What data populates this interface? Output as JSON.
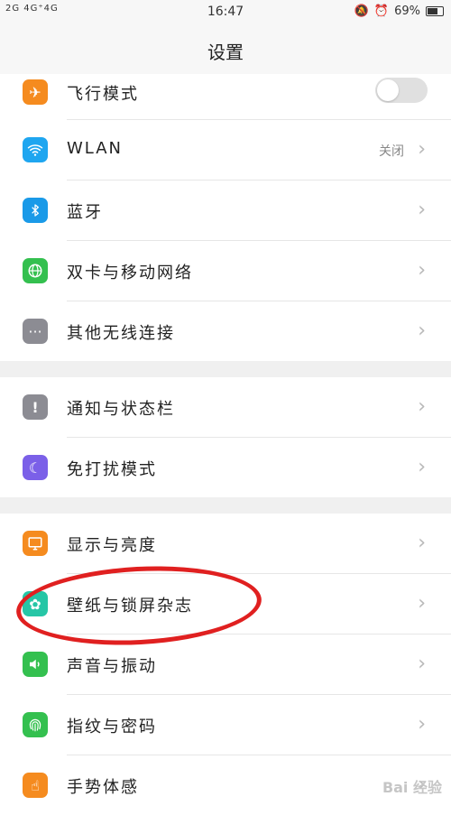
{
  "status_bar": {
    "signal": "2G 4G⁺4G",
    "time": "16:47",
    "battery": "69%"
  },
  "header": {
    "title": "设置"
  },
  "rows": [
    {
      "label": "飞行模式",
      "icon": "airplane-icon",
      "color": "#f58b1f"
    },
    {
      "label": "WLAN",
      "value": "关闭",
      "icon": "wifi-icon",
      "color": "#1fa6f0"
    },
    {
      "label": "蓝牙",
      "icon": "bluetooth-icon",
      "color": "#1a9ae8"
    },
    {
      "label": "双卡与移动网络",
      "icon": "globe-icon",
      "color": "#34c04f"
    },
    {
      "label": "其他无线连接",
      "icon": "more-icon",
      "color": "#8c8c93"
    },
    {
      "label": "通知与状态栏",
      "icon": "exclamation-icon",
      "color": "#8c8c93"
    },
    {
      "label": "免打扰模式",
      "icon": "moon-icon",
      "color": "#7b60e8"
    },
    {
      "label": "显示与亮度",
      "icon": "display-icon",
      "color": "#f58b1f"
    },
    {
      "label": "壁纸与锁屏杂志",
      "icon": "pinwheel-icon",
      "color": "#26c6a6"
    },
    {
      "label": "声音与振动",
      "icon": "speaker-icon",
      "color": "#34c04f"
    },
    {
      "label": "指纹与密码",
      "icon": "fingerprint-icon",
      "color": "#34c04f"
    },
    {
      "label": "手势体感",
      "icon": "hand-icon",
      "color": "#f58b1f"
    }
  ],
  "watermark": "Bai 经验"
}
